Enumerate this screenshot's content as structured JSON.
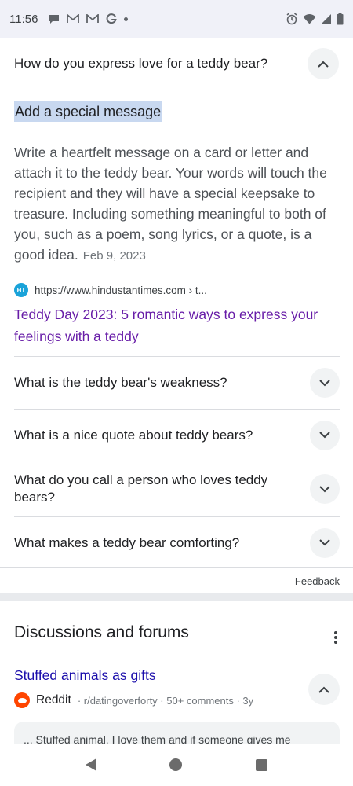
{
  "status_bar": {
    "time": "11:56",
    "left_icons": [
      "chat-bubble-icon",
      "gmail-icon",
      "gmail-icon",
      "google-icon",
      "dot-icon"
    ],
    "right_icons": [
      "alarm-icon",
      "wifi-icon",
      "cell-signal-icon",
      "battery-icon"
    ]
  },
  "faq": {
    "open_question": "How do you express love for a teddy bear?",
    "answer_heading": "Add a special message",
    "answer_body": "Write a heartfelt message on a card or letter and attach it to the teddy bear. Your words will touch the recipient and they will have a special keepsake to treasure. Including something meaningful to both of you, such as a poem, song lyrics, or a quote, is a good idea.",
    "answer_date": "Feb 9, 2023",
    "source_favicon": "HT",
    "source_url": "https://www.hindustantimes.com › t...",
    "source_link": "Teddy Day 2023: 5 romantic ways to express your feelings with a teddy",
    "questions": [
      "What is the teddy bear's weakness?",
      "What is a nice quote about teddy bears?",
      "What do you call a person who loves teddy bears?",
      "What makes a teddy bear comforting?"
    ],
    "feedback": "Feedback"
  },
  "discussions": {
    "title": "Discussions and forums",
    "thread_title": "Stuffed animals as gifts",
    "site": "Reddit",
    "meta": "· r/datingoverforty · 50+ comments · 3y",
    "snippet": "... Stuffed animal. I love them and if someone gives me"
  },
  "colors": {
    "link_visited": "#681da8",
    "link": "#1a0dab",
    "highlight": "#c8d8f0",
    "reddit": "#ff4500"
  }
}
